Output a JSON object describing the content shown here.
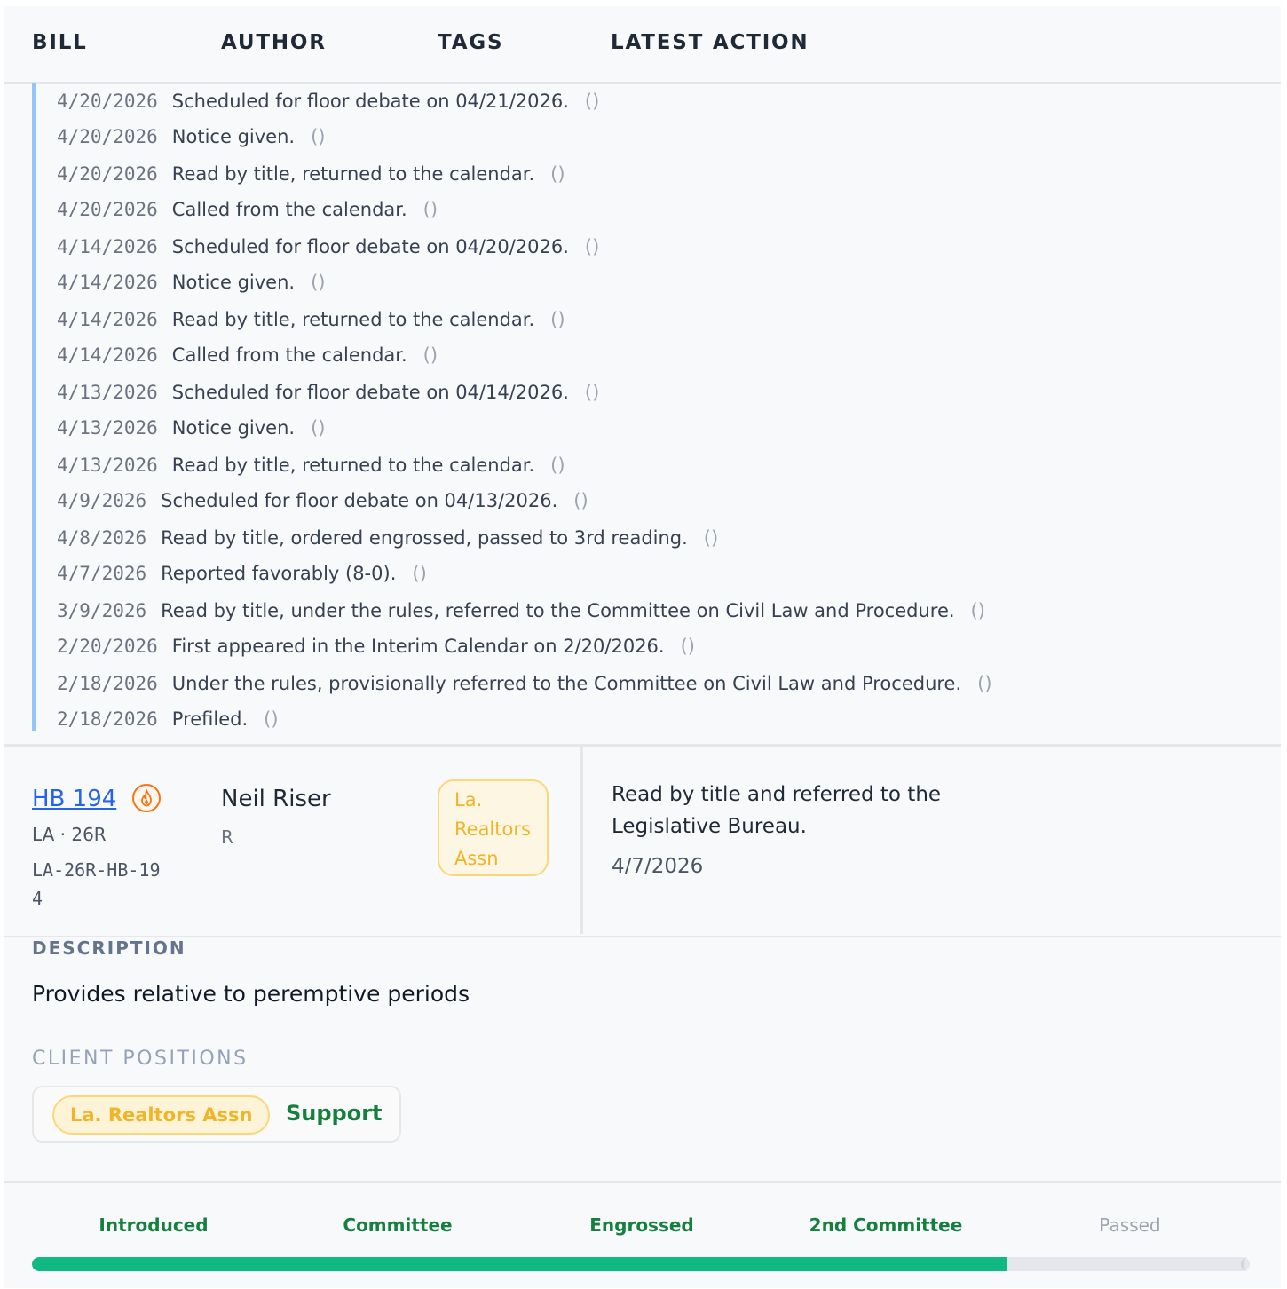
{
  "header": {
    "bill": "BILL",
    "author": "AUTHOR",
    "tags": "TAGS",
    "latest_action": "LATEST ACTION"
  },
  "history": [
    {
      "date": "4/20/2026",
      "text": "Scheduled for floor debate on 04/21/2026.",
      "extra": "()"
    },
    {
      "date": "4/20/2026",
      "text": "Notice given.",
      "extra": "()"
    },
    {
      "date": "4/20/2026",
      "text": "Read by title, returned to the calendar.",
      "extra": "()"
    },
    {
      "date": "4/20/2026",
      "text": "Called from the calendar.",
      "extra": "()"
    },
    {
      "date": "4/14/2026",
      "text": "Scheduled for floor debate on 04/20/2026.",
      "extra": "()"
    },
    {
      "date": "4/14/2026",
      "text": "Notice given.",
      "extra": "()"
    },
    {
      "date": "4/14/2026",
      "text": "Read by title, returned to the calendar.",
      "extra": "()"
    },
    {
      "date": "4/14/2026",
      "text": "Called from the calendar.",
      "extra": "()"
    },
    {
      "date": "4/13/2026",
      "text": "Scheduled for floor debate on 04/14/2026.",
      "extra": "()"
    },
    {
      "date": "4/13/2026",
      "text": "Notice given.",
      "extra": "()"
    },
    {
      "date": "4/13/2026",
      "text": "Read by title, returned to the calendar.",
      "extra": "()"
    },
    {
      "date": "4/9/2026",
      "text": "Scheduled for floor debate on 04/13/2026.",
      "extra": "()"
    },
    {
      "date": "4/8/2026",
      "text": "Read by title, ordered engrossed, passed to 3rd reading.",
      "extra": "()"
    },
    {
      "date": "4/7/2026",
      "text": "Reported favorably (8-0).",
      "extra": "()"
    },
    {
      "date": "3/9/2026",
      "text": "Read by title, under the rules, referred to the Committee on Civil Law and Procedure.",
      "extra": "()"
    },
    {
      "date": "2/20/2026",
      "text": "First appeared in the Interim Calendar on 2/20/2026.",
      "extra": "()"
    },
    {
      "date": "2/18/2026",
      "text": "Under the rules, provisionally referred to the Committee on Civil Law and Procedure.",
      "extra": "()"
    },
    {
      "date": "2/18/2026",
      "text": "Prefiled.",
      "extra": "()"
    }
  ],
  "bill": {
    "number": "HB 194",
    "hot_icon": "flame-icon",
    "session": "LA · 26R",
    "id": "LA-26R-HB-194",
    "author": "Neil Riser",
    "party": "R",
    "tag": "La. Realtors Assn",
    "latest_action": "Read by title and referred to the Legislative Bureau.",
    "latest_action_date": "4/7/2026"
  },
  "description": {
    "label": "DESCRIPTION",
    "text": "Provides relative to peremptive periods"
  },
  "client_positions": {
    "label": "CLIENT POSITIONS",
    "items": [
      {
        "client": "La. Realtors Assn",
        "stance": "Support"
      }
    ]
  },
  "progress": {
    "stages": [
      {
        "label": "Introduced",
        "done": true
      },
      {
        "label": "Committee",
        "done": true
      },
      {
        "label": "Engrossed",
        "done": true
      },
      {
        "label": "2nd Committee",
        "done": true
      },
      {
        "label": "Passed",
        "done": false
      }
    ],
    "fraction_complete": 0.8
  },
  "colors": {
    "link": "#2563eb",
    "history_rail": "#93c5fd",
    "tag": "#f0b429",
    "support": "#15803d",
    "progress_fill": "#10b981",
    "hot": "#f97316"
  }
}
